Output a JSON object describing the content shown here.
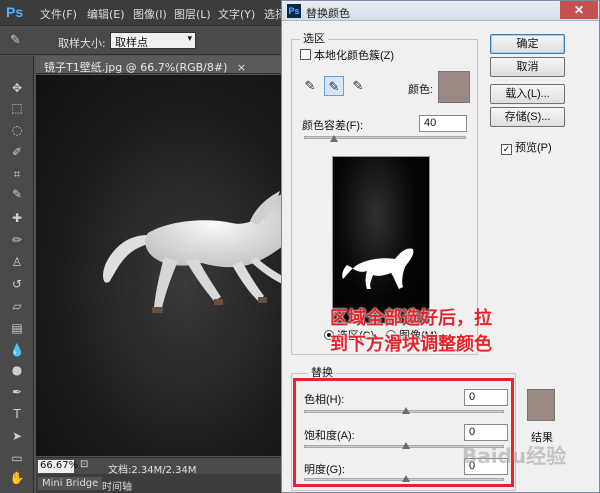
{
  "app": {
    "logo": "Ps"
  },
  "menubar": {
    "items": [
      "文件(F)",
      "编辑(E)",
      "图像(I)",
      "图层(L)",
      "文字(Y)",
      "选择"
    ]
  },
  "options": {
    "sample_size_label": "取样大小:",
    "sample_size_value": "取样点"
  },
  "document": {
    "tab_title": "镜子T1壁纸.jpg @ 66.7%(RGB/8#)",
    "zoom": "66.67%",
    "doc_info": "文档:2.34M/2.34M"
  },
  "bottom_tabs": [
    "Mini Bridge",
    "时间轴"
  ],
  "dialog": {
    "title": "替换颜色",
    "selection": {
      "group_label": "选区",
      "localized_label": "本地化颜色簇(Z)",
      "color_label": "颜色:",
      "color_value": "#9a8883",
      "fuzziness_label": "颜色容差(F):",
      "fuzziness_value": "40",
      "fuzziness_fraction": 0.2,
      "radio_selection": "选区(C)",
      "radio_image": "图像(M)",
      "radio_selected": "selection"
    },
    "buttons": {
      "ok": "确定",
      "cancel": "取消",
      "load": "载入(L)...",
      "save": "存储(S)..."
    },
    "preview_label": "预览(P)",
    "preview_checked": true,
    "replacement": {
      "group_label": "替换",
      "hue_label": "色相(H):",
      "hue_value": "0",
      "saturation_label": "饱和度(A):",
      "saturation_value": "0",
      "lightness_label": "明度(G):",
      "lightness_value": "0",
      "result_label": "结果",
      "result_color": "#9a8883"
    }
  },
  "annotation": {
    "line1": "区域全部选好后，拉",
    "line2": "到下方滑块调整颜色",
    "color": "#e8232b"
  },
  "watermark": "Baidu经验"
}
